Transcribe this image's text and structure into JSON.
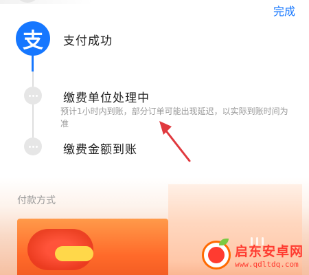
{
  "header": {
    "done_label": "完成"
  },
  "timeline": {
    "logo_char": "支",
    "steps": [
      {
        "title": "支付成功",
        "status": "done"
      },
      {
        "title": "缴费单位处理中",
        "status": "pending",
        "description": "预计1小时内到账，部分订单可能出现延迟，以实际到账时间为准"
      },
      {
        "title": "缴费金额到账",
        "status": "pending"
      }
    ]
  },
  "payment": {
    "method_label": "付款方式"
  },
  "watermark": {
    "name": "启东安卓网",
    "url": "www.qdltdq.com"
  },
  "colors": {
    "accent": "#1677ff",
    "muted": "#999999",
    "step_pending": "#e6e6e6",
    "arrow": "#e0393e",
    "watermark": "#ff3b30"
  }
}
